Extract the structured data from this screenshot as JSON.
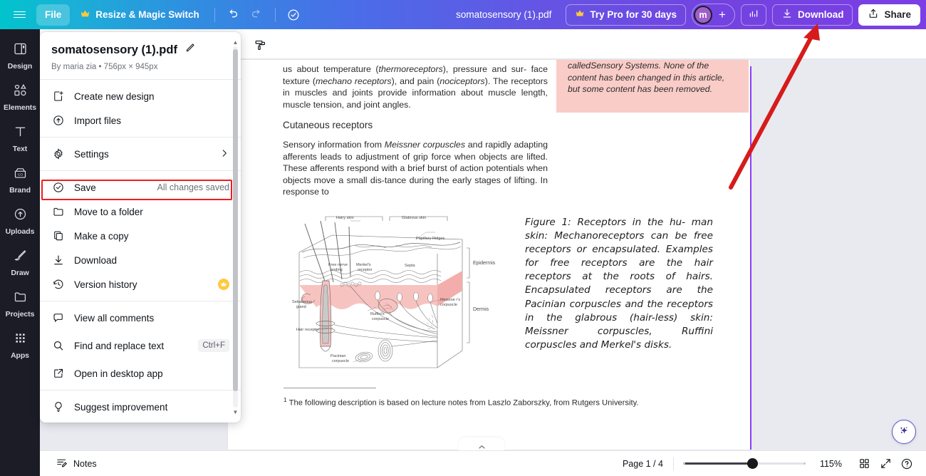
{
  "topbar": {
    "menu_icon": "hamburger-icon",
    "file_label": "File",
    "resize_label": "Resize & Magic Switch",
    "resize_icon": "crown-icon",
    "undo_icon": "undo-arrow-icon",
    "redo_icon": "redo-arrow-icon",
    "cloud_saved_icon": "cloud-check-icon",
    "doc_title": "somatosensory (1).pdf",
    "try_pro_label": "Try Pro for 30 days",
    "try_pro_icon": "crown-icon",
    "avatar_initial": "m",
    "add_member_label": "+",
    "insights_icon": "bar-chart-icon",
    "download_label": "Download",
    "download_icon": "download-arrow-icon",
    "share_label": "Share",
    "share_icon": "share-up-icon"
  },
  "rail": {
    "items": [
      {
        "label": "Design",
        "icon": "design-panel-icon"
      },
      {
        "label": "Elements",
        "icon": "shapes-icon"
      },
      {
        "label": "Text",
        "icon": "text-t-icon"
      },
      {
        "label": "Brand",
        "icon": "brand-box-icon"
      },
      {
        "label": "Uploads",
        "icon": "cloud-upload-icon"
      },
      {
        "label": "Draw",
        "icon": "pen-draw-icon"
      },
      {
        "label": "Projects",
        "icon": "folder-icon"
      },
      {
        "label": "Apps",
        "icon": "grid-dots-icon"
      }
    ]
  },
  "file_menu": {
    "title": "somatosensory (1).pdf",
    "edit_icon": "pencil-icon",
    "subtitle": "By maria zia • 756px × 945px",
    "groups": [
      {
        "items": [
          {
            "label": "Create new design",
            "icon": "new-design-icon",
            "right": "",
            "chevron": false,
            "crown": false
          },
          {
            "label": "Import files",
            "icon": "import-cloud-icon",
            "right": "",
            "chevron": false,
            "crown": false
          }
        ]
      },
      {
        "items": [
          {
            "label": "Settings",
            "icon": "gear-icon",
            "right": "",
            "chevron": true,
            "crown": false
          }
        ]
      },
      {
        "items": [
          {
            "label": "Save",
            "icon": "cloud-check-icon",
            "right": "All changes saved",
            "chevron": false,
            "crown": false,
            "highlighted": true
          },
          {
            "label": "Move to a folder",
            "icon": "folder-icon",
            "right": "",
            "chevron": false,
            "crown": false
          },
          {
            "label": "Make a copy",
            "icon": "copy-icon",
            "right": "",
            "chevron": false,
            "crown": false
          },
          {
            "label": "Download",
            "icon": "download-arrow-icon",
            "right": "",
            "chevron": false,
            "crown": false
          },
          {
            "label": "Version history",
            "icon": "history-clock-icon",
            "right": "",
            "chevron": false,
            "crown": true
          }
        ]
      },
      {
        "items": [
          {
            "label": "View all comments",
            "icon": "comment-bubble-icon",
            "right": "",
            "chevron": false,
            "crown": false
          },
          {
            "label": "Find and replace text",
            "icon": "search-icon",
            "right": "Ctrl+F",
            "chevron": false,
            "crown": false,
            "tall": true
          },
          {
            "label": "Open in desktop app",
            "icon": "external-link-icon",
            "right": "",
            "chevron": false,
            "crown": false
          }
        ]
      },
      {
        "items": [
          {
            "label": "Suggest improvement",
            "icon": "lightbulb-icon",
            "right": "",
            "chevron": false,
            "crown": false
          }
        ]
      }
    ]
  },
  "toolstrip": {
    "style_copy_icon": "paint-roller-icon"
  },
  "document": {
    "paragraph_1_html": "us about temperature (<em>thermoreceptors</em>), pressure and sur- face texture (<em>mechano receptors</em>), and pain (<em>nociceptors</em>). The receptors in muscles and joints provide information about muscle length, muscle tension, and joint angles.",
    "heading_1": "Cutaneous receptors",
    "paragraph_2_html": "Sensory information from <em>Meissner corpuscles</em> and rapidly adapting afferents leads to adjustment of grip force when objects are lifted. These afferents respond with a brief burst of action potentials when objects move a small dis-tance during the early stages of lifting. In response to",
    "note_box_text": "contains a chapter from a Wikibook calledSensory Systems. None of the content has been changed in this article, but some content has been removed.",
    "note_box_color": "#f9ccc8",
    "figure_caption": "Figure 1: Receptors in the hu- man skin: Mechanoreceptors can be free receptors or encapsulated. Examples for free receptors are the hair receptors at the roots of hairs. Encapsulated receptors are the Pacinian corpuscles and the receptors in the glabrous (hair-less) skin: Meissner corpuscles, Ruffini corpuscles and Merkel's disks.",
    "footnote_marker": "1",
    "footnote_text": "The following description is based on lecture notes from Laszlo Zaborszky, from Rutgers University.",
    "figure_labels": {
      "hairy_skin": "Hairy skin",
      "glabrous_skin": "Glabrous skin",
      "papillary_ridges": "Papillary Ridges",
      "epidermis": "Epidermis",
      "dermis": "Dermis",
      "septa": "Septa",
      "free_nerve_ending": "Free nerve ending",
      "merkel_receptor": "Merkel's receptor",
      "meissner_corpuscle": "Meissne r's corpuscle",
      "ruffini_corpuscle": "Ruffini's corpuscle",
      "sebaceous_gland": "Sebaceous gland",
      "hair_receptor": "Hair receptor",
      "pacinian_corpuscle": "Pacinian corpuscle"
    }
  },
  "bottombar": {
    "notes_label": "Notes",
    "notes_icon": "notes-lines-icon",
    "page_indicator": "Page 1 / 4",
    "zoom_level": "115%",
    "grid_icon": "grid-view-icon",
    "fullscreen_icon": "expand-arrows-icon",
    "help_icon": "question-circle-icon"
  },
  "overlay": {
    "magic_icon": "sparkle-icon",
    "annotation_arrow_color": "#d61b1b",
    "save_highlight_color": "#f11d1d"
  }
}
